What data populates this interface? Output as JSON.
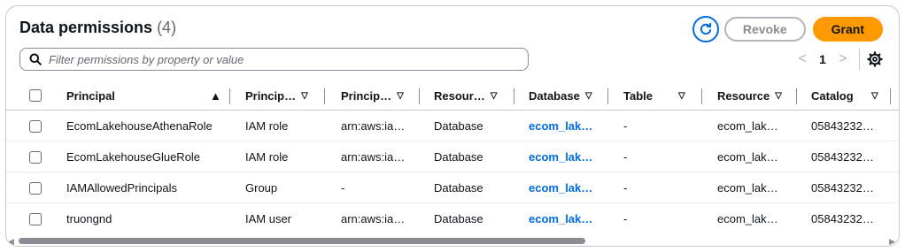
{
  "header": {
    "title": "Data permissions",
    "count": "(4)"
  },
  "actions": {
    "revoke_label": "Revoke",
    "grant_label": "Grant"
  },
  "filter": {
    "placeholder": "Filter permissions by property or value"
  },
  "pager": {
    "current_page": "1",
    "prev": "<",
    "next": ">"
  },
  "columns": [
    "Principal",
    "Princip…",
    "Princip…",
    "Resour…",
    "Database",
    "Table",
    "Resource",
    "Catalog"
  ],
  "rows": [
    [
      "EcomLakehouseAthenaRole",
      "IAM role",
      "arn:aws:ia…",
      "Database",
      "ecom_lak…",
      "-",
      "ecom_lak…",
      "05843232…"
    ],
    [
      "EcomLakehouseGlueRole",
      "IAM role",
      "arn:aws:ia…",
      "Database",
      "ecom_lak…",
      "-",
      "ecom_lak…",
      "05843232…"
    ],
    [
      "IAMAllowedPrincipals",
      "Group",
      "-",
      "Database",
      "ecom_lak…",
      "-",
      "ecom_lak…",
      "05843232…"
    ],
    [
      "truongnd",
      "IAM user",
      "arn:aws:ia…",
      "Database",
      "ecom_lak…",
      "-",
      "ecom_lak…",
      "05843232…"
    ]
  ],
  "colors": {
    "accent": "#006ce0",
    "grant": "#ff9900"
  },
  "icons": [
    "refresh-icon",
    "search-icon",
    "settings-icon",
    "sort-ascending-icon",
    "sort-descending-icon"
  ]
}
